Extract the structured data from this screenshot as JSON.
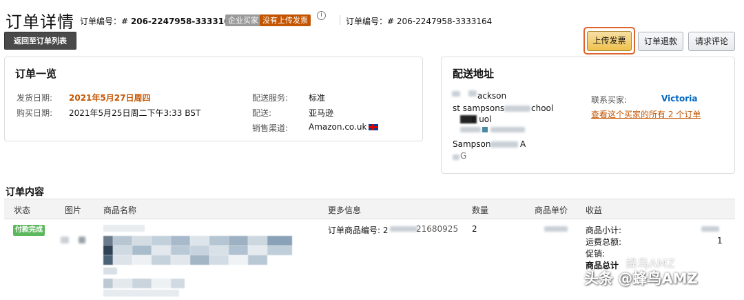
{
  "header": {
    "title": "订单详情",
    "order_label": "订单编号：# ",
    "order_number": "206-2247958-3333164",
    "badge_business": "企业买家",
    "badge_no_invoice": "没有上传发票",
    "info_icon": "i",
    "order_label2": "订单编号：# 206-2247958-3333164"
  },
  "actions": {
    "back_label": "返回至订单列表",
    "upload_invoice": "上传发票",
    "refund": "订单退款",
    "request_review": "请求评论"
  },
  "overview": {
    "title": "订单一览",
    "ship_date_label": "发货日期:",
    "ship_date_value": "2021年5月27日周四",
    "purchase_date_label": "购买日期:",
    "purchase_date_value": "2021年5月25日周二下午3:33 BST",
    "ship_service_label": "配送服务:",
    "ship_service_value": "标准",
    "fulfillment_label": "配送:",
    "fulfillment_value": "亚马逊",
    "channel_label": "销售渠道:",
    "channel_value": "Amazon.co.uk",
    "flag_icon": "uk-flag-icon"
  },
  "shipping": {
    "title": "配送地址",
    "line1": "ackson",
    "line2": "st sampsons",
    "line2b": "chool",
    "line3": "e uol",
    "line4": "Sampson",
    "line4b": "A",
    "line5": "G",
    "contact_label": "联系买家:",
    "buyer_name": "Victoria",
    "all_orders_link": "查看这个买家的所有 2 个订单"
  },
  "content": {
    "title": "订单内容",
    "columns": [
      "状态",
      "图片",
      "商品名称",
      "更多信息",
      "数量",
      "商品单价",
      "收益"
    ],
    "row": {
      "status": "付款完成",
      "more_info": "订单商品编号: 2",
      "more_info_tail": "21680925",
      "quantity": "2"
    },
    "summary": {
      "subtotal_label": "商品小计:",
      "shipping_label": "运费总额:",
      "promo_label": "促销:",
      "total_label": "商品总计",
      "shipping_value": "1"
    }
  },
  "watermark": {
    "main": "头条 @蜂鸟AMZ",
    "secondary": "蜂鸟AMZ"
  }
}
